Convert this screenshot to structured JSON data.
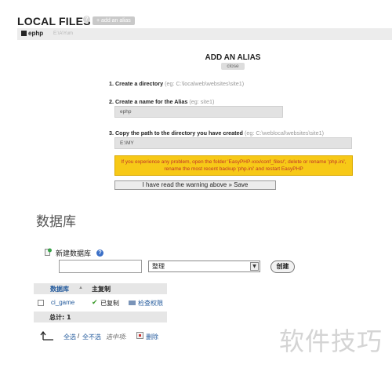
{
  "header": {
    "title": "LOCAL FILES",
    "help": "?",
    "add_alias": "+ add an alias"
  },
  "tabs": {
    "active_label": "ephp",
    "path": "E:\\A\\Yum"
  },
  "alias_panel": {
    "title": "ADD AN ALIAS",
    "close": "close",
    "step1_label": "1. Create a directory",
    "step1_eg": "(eg: C:\\localweb\\websites\\site1)",
    "step2_label": "2. Create a name for the Alias",
    "step2_eg": "(eg: site1)",
    "name_value": "ephp",
    "step3_label": "3. Copy the path to the directory you have created",
    "step3_eg": "(eg: C:\\weblocal\\websites\\site1)",
    "path_value": "E:\\MY",
    "warning": "If you experience any problem, open the folder 'EasyPHP-xxx/conf_files/', delete or rename 'php.ini', rename the most recent backup 'php.ini' and restart EasyPHP",
    "save_label": "I have read the warning above » Save"
  },
  "database": {
    "title": "数据库",
    "new_db_label": "新建数据库",
    "new_db_help": "?",
    "name_input_value": "",
    "collation_value": "整理",
    "create_label": "创建",
    "table": {
      "col_db": "数据库",
      "col_sort": "▲",
      "col_repl": "主复制",
      "rows": [
        {
          "name": "ci_game",
          "check": "✔",
          "replicated": "已复制",
          "privileges": "检查权限"
        }
      ],
      "total": "总计: 1"
    },
    "footer": {
      "select_all": "全选",
      "separator": "/",
      "select_none": "全不选",
      "selected_text": "选中项:",
      "delete_label": "删除"
    }
  },
  "watermark": "软件技巧",
  "colors": {
    "warning_bg": "#f7c917",
    "warning_text": "#c0342a",
    "link": "#235a9c",
    "check_green": "#3a9a2a"
  }
}
